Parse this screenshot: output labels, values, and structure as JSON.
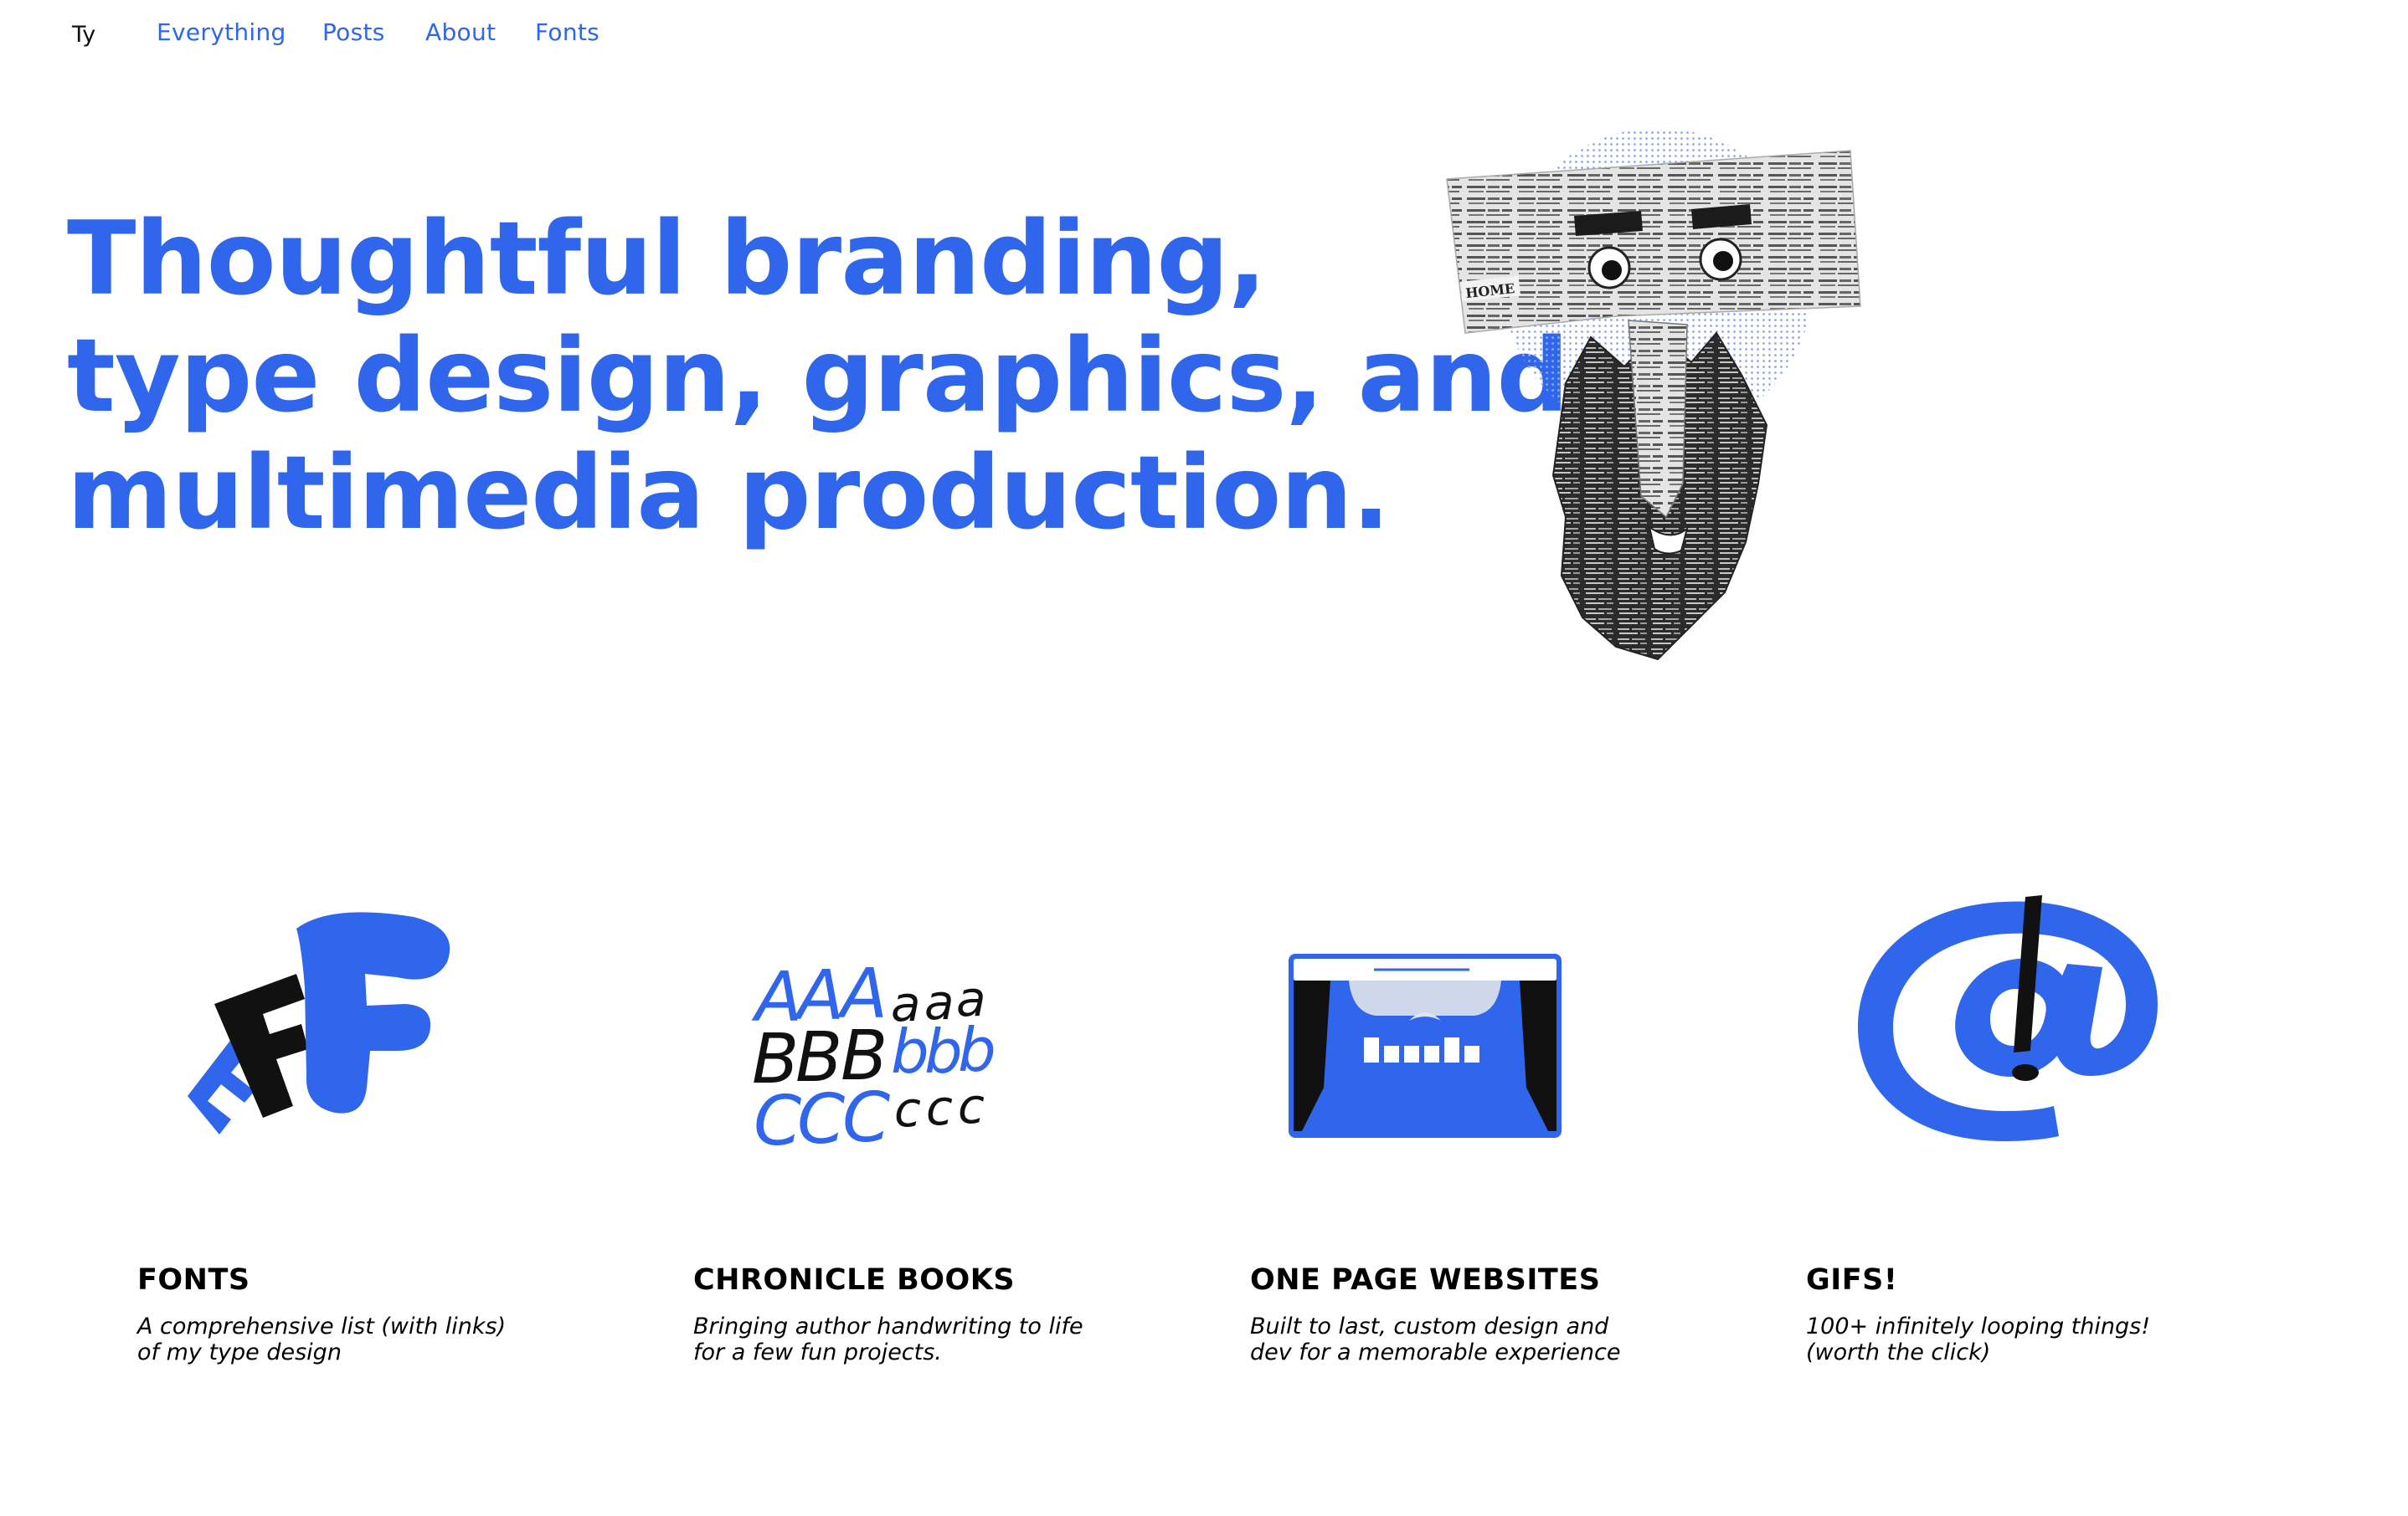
{
  "nav": {
    "logo": "Ty",
    "links": [
      {
        "label": "Everything"
      },
      {
        "label": "Posts"
      },
      {
        "label": "About"
      },
      {
        "label": "Fonts"
      }
    ]
  },
  "hero": {
    "lines": [
      "Thoughtful branding,",
      "type design, graphics, and",
      "multimedia production."
    ]
  },
  "portrait": {
    "newspaper_words": [
      "Capt. Comme",
      "is given as",
      "cadence is",
      "joined the",
      "them are",
      "this State.",
      "N. G.",
      "HOME",
      "a Moss.",
      "nothing to",
      "found",
      "rice w",
      "bleach.",
      "arms;",
      "has",
      "healed.",
      "two card of",
      "the second",
      "Moses,",
      "suggests",
      "Fine Laundering.",
      "beautifully",
      "specimen of",
      "arrange"
    ]
  },
  "cards": [
    {
      "title": "FONTS",
      "description": "A comprehensive list (with links) of my type design"
    },
    {
      "title": "CHRONICLE BOOKS",
      "description": "Bringing author handwriting to life for a few fun projects.",
      "art": {
        "row_upper": [
          "A",
          "A",
          "A",
          "B",
          "B",
          "B",
          "C",
          "C",
          "C"
        ],
        "row_lower": [
          "a",
          "a",
          "a",
          "b",
          "b",
          "b",
          "c",
          "c",
          "c"
        ]
      }
    },
    {
      "title": "ONE PAGE WEBSITES",
      "description": "Built to last, custom design and dev for a memorable experience"
    },
    {
      "title": "GIFS!",
      "description": "100+ infinitely looping things! (worth the click)"
    }
  ],
  "colors": {
    "accent": "#2f66ec",
    "text": "#000000",
    "background": "#ffffff"
  }
}
